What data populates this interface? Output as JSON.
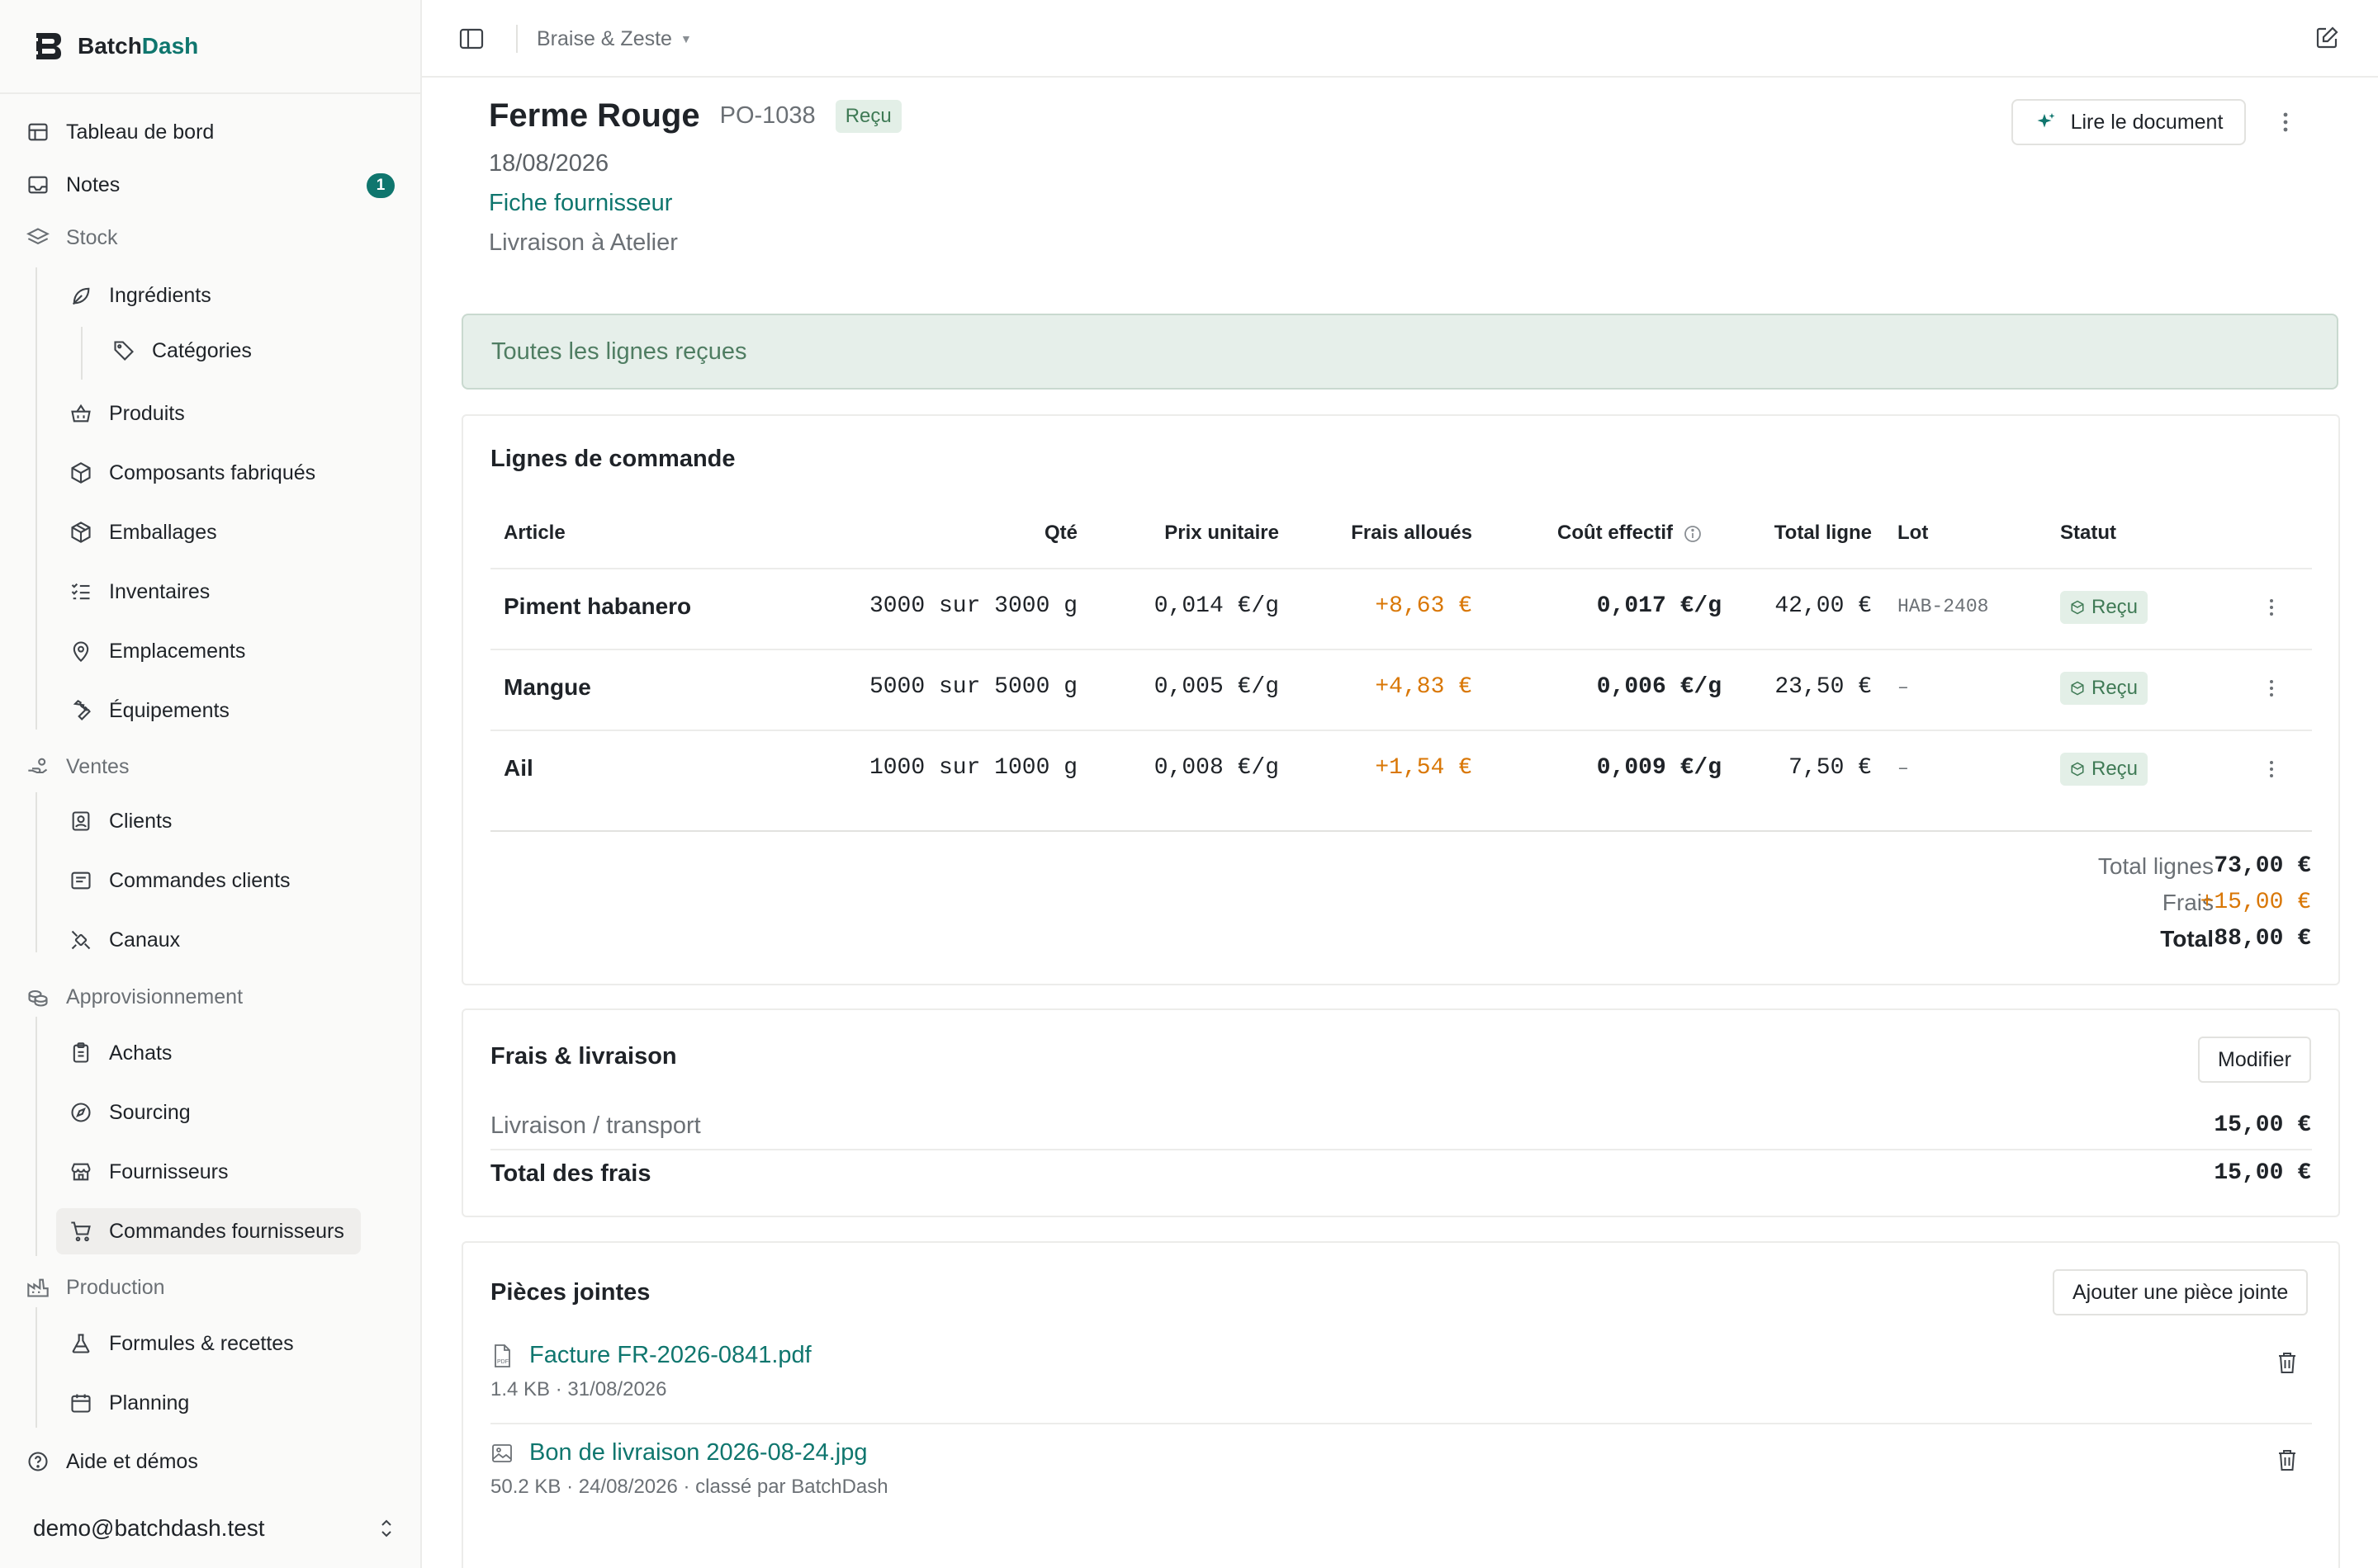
{
  "app": {
    "name_part1": "Batch",
    "name_part2": "Dash"
  },
  "sidebar": {
    "items": [
      {
        "label": "Tableau de bord",
        "icon": "dashboard-icon"
      },
      {
        "label": "Notes",
        "icon": "inbox-icon",
        "badge": "1"
      },
      {
        "label": "Stock",
        "icon": "layers-icon"
      },
      {
        "label": "Ingrédients",
        "icon": "leaf-icon"
      },
      {
        "label": "Catégories",
        "icon": "tag-icon"
      },
      {
        "label": "Produits",
        "icon": "basket-icon"
      },
      {
        "label": "Composants fabriqués",
        "icon": "box-icon"
      },
      {
        "label": "Emballages",
        "icon": "package-icon"
      },
      {
        "label": "Inventaires",
        "icon": "checklist-icon"
      },
      {
        "label": "Emplacements",
        "icon": "map-pin-icon"
      },
      {
        "label": "Équipements",
        "icon": "wrench-icon"
      },
      {
        "label": "Ventes",
        "icon": "hand-coins-icon"
      },
      {
        "label": "Clients",
        "icon": "contact-icon"
      },
      {
        "label": "Commandes clients",
        "icon": "receipt-icon"
      },
      {
        "label": "Canaux",
        "icon": "satellite-icon"
      },
      {
        "label": "Approvisionnement",
        "icon": "coins-icon"
      },
      {
        "label": "Achats",
        "icon": "clipboard-icon"
      },
      {
        "label": "Sourcing",
        "icon": "compass-icon"
      },
      {
        "label": "Fournisseurs",
        "icon": "store-icon"
      },
      {
        "label": "Commandes fournisseurs",
        "icon": "cart-icon"
      },
      {
        "label": "Production",
        "icon": "factory-icon"
      },
      {
        "label": "Formules & recettes",
        "icon": "flask-icon"
      },
      {
        "label": "Planning",
        "icon": "calendar-icon"
      },
      {
        "label": "Aide et démos",
        "icon": "help-icon"
      }
    ],
    "user_email": "demo@batchdash.test"
  },
  "topbar": {
    "workspace": "Braise & Zeste"
  },
  "purchase_order": {
    "supplier": "Ferme Rouge",
    "number": "PO-1038",
    "status": "Reçu",
    "date": "18/08/2026",
    "supplier_link": "Fiche fournisseur",
    "delivery": "Livraison à Atelier",
    "read_document_label": "Lire le document"
  },
  "alert": {
    "text": "Toutes les lignes reçues"
  },
  "lines": {
    "title": "Lignes de commande",
    "headers": {
      "article": "Article",
      "qty": "Qté",
      "unit_price": "Prix unitaire",
      "fees": "Frais alloués",
      "effective_cost": "Coût effectif",
      "line_total": "Total ligne",
      "lot": "Lot",
      "status": "Statut"
    },
    "rows": [
      {
        "article": "Piment habanero",
        "qty": "3000 sur 3000 g",
        "unit_price": "0,014 €/g",
        "fees": "+8,63 €",
        "effective_cost": "0,017 €/g",
        "line_total": "42,00 €",
        "lot": "HAB-2408",
        "status": "Reçu"
      },
      {
        "article": "Mangue",
        "qty": "5000 sur 5000 g",
        "unit_price": "0,005 €/g",
        "fees": "+4,83 €",
        "effective_cost": "0,006 €/g",
        "line_total": "23,50 €",
        "lot": "–",
        "status": "Reçu"
      },
      {
        "article": "Ail",
        "qty": "1000 sur 1000 g",
        "unit_price": "0,008 €/g",
        "fees": "+1,54 €",
        "effective_cost": "0,009 €/g",
        "line_total": "7,50 €",
        "lot": "–",
        "status": "Reçu"
      }
    ],
    "totals": {
      "lines_label": "Total lignes",
      "lines_value": "73,00 €",
      "fees_label": "Frais",
      "fees_value": "+15,00 €",
      "total_label": "Total",
      "total_value": "88,00 €"
    }
  },
  "fees": {
    "title": "Frais & livraison",
    "edit_label": "Modifier",
    "item_label": "Livraison / transport",
    "item_value": "15,00 €",
    "total_label": "Total des frais",
    "total_value": "15,00 €"
  },
  "attachments": {
    "title": "Pièces jointes",
    "add_label": "Ajouter une pièce jointe",
    "items": [
      {
        "name": "Facture FR-2026-0841.pdf",
        "meta": "1.4 KB · 31/08/2026",
        "icon": "pdf-file-icon"
      },
      {
        "name": "Bon de livraison 2026-08-24.jpg",
        "meta": "50.2 KB · 24/08/2026 · classé par BatchDash",
        "icon": "image-file-icon"
      }
    ]
  },
  "colors": {
    "accent": "#0f766e",
    "fee": "#d97706",
    "status_bg": "#e3efe7",
    "status_text": "#3f7a55"
  }
}
